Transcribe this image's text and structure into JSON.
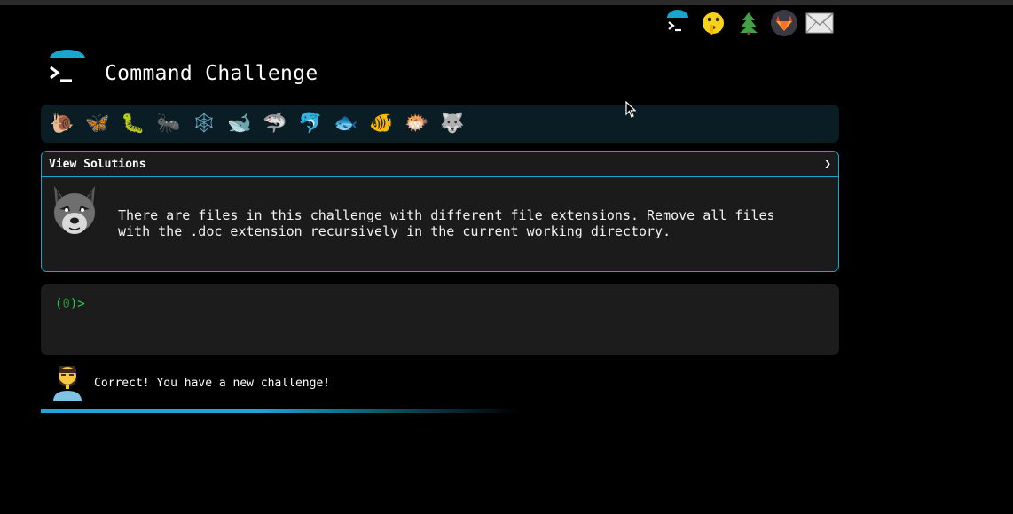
{
  "header": {
    "title": "Command Challenge",
    "top_icons": [
      {
        "name": "terminal-icon",
        "glyph": ">_"
      },
      {
        "name": "shush-emoji-icon",
        "glyph": "🤫"
      },
      {
        "name": "tree-icon",
        "glyph": "🌲"
      },
      {
        "name": "gitlab-icon",
        "glyph": "🦊"
      },
      {
        "name": "mail-icon",
        "glyph": "✉"
      }
    ]
  },
  "levels": [
    {
      "name": "snail",
      "glyph": "🐌"
    },
    {
      "name": "butterfly",
      "glyph": "🦋"
    },
    {
      "name": "caterpillar",
      "glyph": "🐛"
    },
    {
      "name": "ant",
      "glyph": "🐜"
    },
    {
      "name": "spider-web",
      "glyph": "🕸"
    },
    {
      "name": "whale",
      "glyph": "🐋"
    },
    {
      "name": "shark",
      "glyph": "🦈"
    },
    {
      "name": "dolphin",
      "glyph": "🐬"
    },
    {
      "name": "fish",
      "glyph": "🐟"
    },
    {
      "name": "tropical-fish",
      "glyph": "🐠"
    },
    {
      "name": "blowfish",
      "glyph": "🐡"
    },
    {
      "name": "wolf",
      "glyph": "🐺"
    }
  ],
  "challenge": {
    "solutions_label": "View Solutions",
    "chevron": "❯",
    "description": "There are files in this challenge with different file extensions. Remove all files\nwith the .doc extension recursively in the current working directory."
  },
  "terminal": {
    "prompt_open": "(",
    "prompt_num": "0",
    "prompt_close": ")>"
  },
  "feedback": {
    "message": "Correct! You have a new challenge!"
  },
  "progress": {
    "fraction": 0.47
  },
  "colors": {
    "accent": "#17a6cc",
    "prompt_green": "#2bd14a",
    "level_bar": "#0a1d24"
  }
}
